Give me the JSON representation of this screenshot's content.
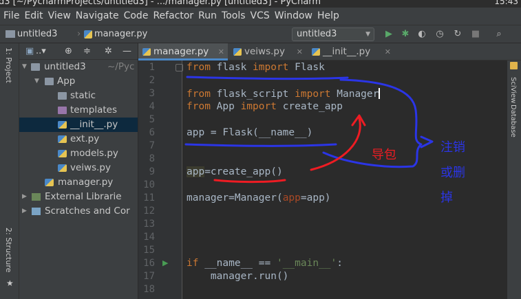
{
  "window": {
    "title": "d3 [~/PycharmProjects/untitled3] - .../manager.py [untitled3] - PyCharm",
    "clock": "15:43"
  },
  "menu": [
    "File",
    "Edit",
    "View",
    "Navigate",
    "Code",
    "Refactor",
    "Run",
    "Tools",
    "VCS",
    "Window",
    "Help"
  ],
  "breadcrumb": {
    "project": "untitled3",
    "file": "manager.py"
  },
  "run_config": {
    "label": "untitled3"
  },
  "project_panel": {
    "tree": [
      {
        "label": "untitled3",
        "hint": "~/Pyc",
        "kind": "folder",
        "depth": 0,
        "open": true
      },
      {
        "label": "App",
        "kind": "pkg",
        "depth": 1,
        "open": true
      },
      {
        "label": "static",
        "kind": "folder",
        "depth": 2
      },
      {
        "label": "templates",
        "kind": "tmpl",
        "depth": 2
      },
      {
        "label": "__init__.py",
        "kind": "py",
        "depth": 2,
        "selected": true
      },
      {
        "label": "ext.py",
        "kind": "py",
        "depth": 2
      },
      {
        "label": "models.py",
        "kind": "py",
        "depth": 2
      },
      {
        "label": "veiws.py",
        "kind": "py",
        "depth": 2
      },
      {
        "label": "manager.py",
        "kind": "py",
        "depth": 1
      },
      {
        "label": "External Librarie",
        "kind": "ext",
        "depth": 0
      },
      {
        "label": "Scratches and Cor",
        "kind": "scr",
        "depth": 0
      }
    ]
  },
  "left_strip": {
    "top_label": "1: Project",
    "bottom_label": "2: Structure",
    "star": "★"
  },
  "right_strip": {
    "label_a": "SciView",
    "label_b": "Database"
  },
  "tabs": [
    {
      "label": "manager.py",
      "active": true
    },
    {
      "label": "veiws.py",
      "active": false
    },
    {
      "label": "__init__.py",
      "active": false
    }
  ],
  "line_numbers": [
    "1",
    "2",
    "3",
    "4",
    "5",
    "6",
    "7",
    "8",
    "9",
    "10",
    "11",
    "12",
    "13",
    "14",
    "15",
    "16",
    "17",
    "18"
  ],
  "annotations": {
    "import_note": "导包",
    "comment_note_1": "注销",
    "comment_note_2": "或删",
    "comment_note_3": "掉"
  },
  "colors": {
    "accent": "#4a88c7",
    "keyword": "#cc7832",
    "pen_blue": "#2b35e6",
    "pen_red": "#ee1c23"
  }
}
